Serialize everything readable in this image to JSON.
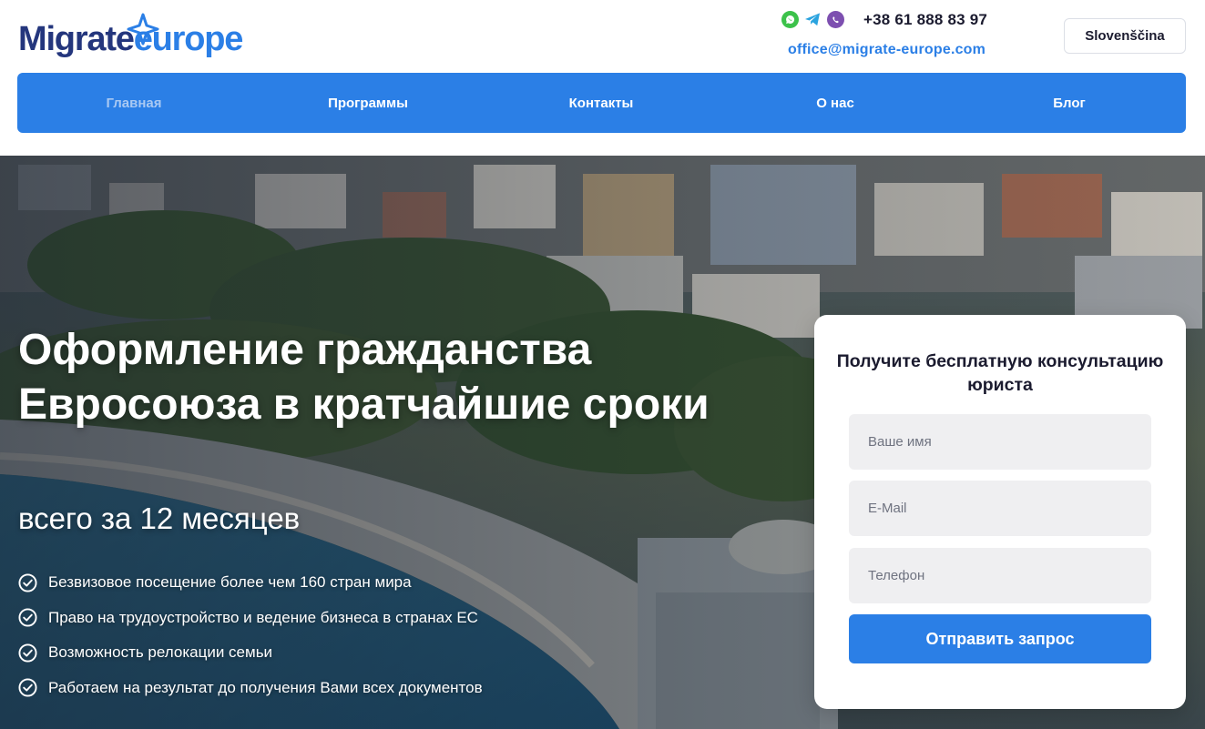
{
  "header": {
    "logo": {
      "part1": "Migrate",
      "part2": "europe"
    },
    "messengers": [
      "whatsapp-icon",
      "telegram-icon",
      "viber-icon"
    ],
    "phone": "+38 61 888 83 97",
    "email": "office@migrate-europe.com",
    "language": "Slovenščina"
  },
  "nav": {
    "items": [
      {
        "label": "Главная",
        "active": true
      },
      {
        "label": "Программы",
        "active": false
      },
      {
        "label": "Контакты",
        "active": false
      },
      {
        "label": "О нас",
        "active": false
      },
      {
        "label": "Блог",
        "active": false
      }
    ]
  },
  "hero": {
    "title": "Оформление гражданства Евросоюза в кратчайшие сроки",
    "subtitle": "всего за 12 месяцев",
    "benefits": [
      "Безвизовое посещение более чем 160 стран мира",
      "Право на трудоустройство и ведение бизнеса в странах ЕС",
      "Возможность релокации семьи",
      "Работаем на результат до получения Вами всех документов"
    ]
  },
  "form": {
    "title": "Получите бесплатную консультацию юриста",
    "name_placeholder": "Ваше имя",
    "email_placeholder": "E-Mail",
    "phone_placeholder": "Телефон",
    "submit_label": "Отправить запрос"
  },
  "colors": {
    "brand_dark": "#24367d",
    "brand_blue": "#2b7fe6",
    "nav_active": "#a9c9f3"
  }
}
